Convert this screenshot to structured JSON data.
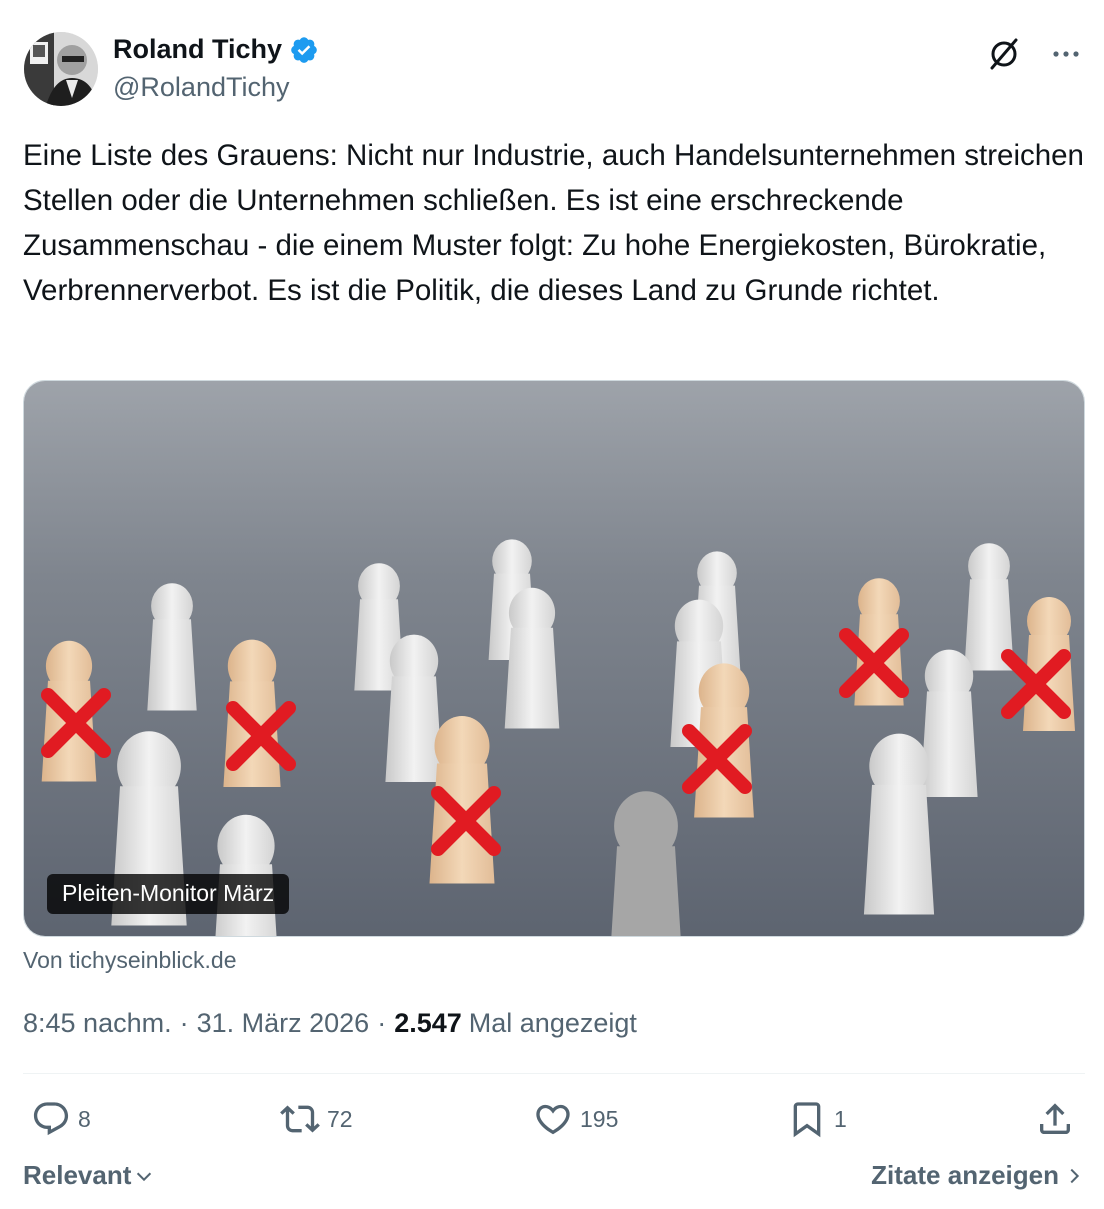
{
  "author": {
    "name": "Roland Tichy",
    "handle": "@RolandTichy",
    "verified_color": "#1d9bf0"
  },
  "tweet": {
    "text": "Eine Liste des Grauens: Nicht nur Industrie, auch Handelsunternehmen streichen Stellen oder die Unternehmen schließen. Es ist eine erschreckende Zusammenschau - die einem Muster folgt: Zu hohe Energiekosten, Bürokratie, Verbrennerverbot. Es ist die Politik, die dieses Land zu Grunde richtet."
  },
  "card": {
    "title": "Pleiten-Monitor März",
    "source": "Von tichyseinblick.de"
  },
  "meta": {
    "time": "8:45 nachm.",
    "separator": "·",
    "date": "31. März 2026",
    "views_count": "2.547",
    "views_label": "Mal angezeigt"
  },
  "actions": {
    "replies": "8",
    "reposts": "72",
    "likes": "195",
    "bookmarks": "1"
  },
  "footer": {
    "sort_label": "Relevant",
    "quotes_label": "Zitate anzeigen"
  },
  "icons": [
    "verified-badge-icon",
    "grok-icon",
    "more-icon",
    "reply-icon",
    "repost-icon",
    "like-icon",
    "bookmark-icon",
    "share-icon",
    "chevron-down-icon",
    "chevron-right-icon"
  ],
  "colors": {
    "text_primary": "#0f1419",
    "text_secondary": "#536471",
    "accent": "#1d9bf0",
    "mark_red": "#e11b22"
  }
}
